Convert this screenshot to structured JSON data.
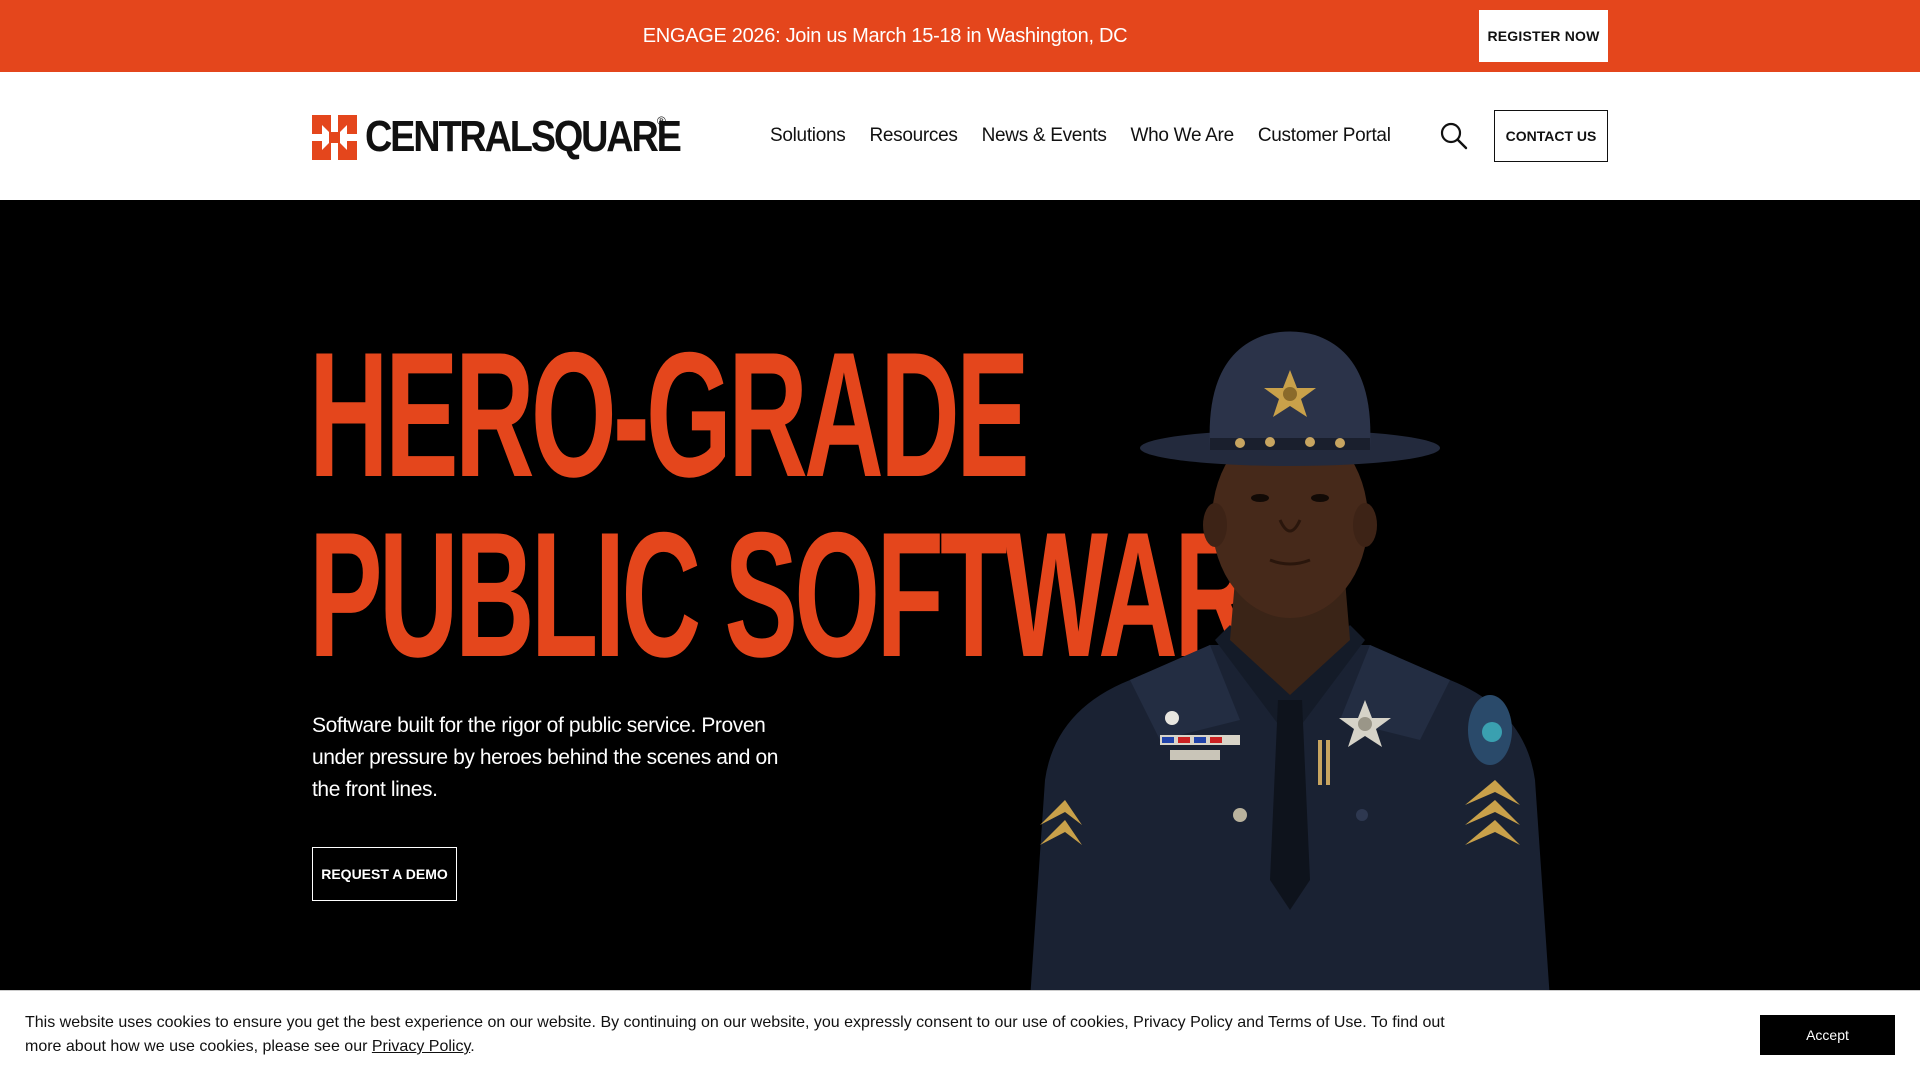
{
  "announcement": {
    "text": "ENGAGE 2026: Join us March 15-18 in Washington, DC",
    "register_label": "REGISTER NOW"
  },
  "header": {
    "logo_text": "CENTRALSQUARE",
    "logo_registered": "®",
    "nav": [
      "Solutions",
      "Resources",
      "News & Events",
      "Who We Are",
      "Customer Portal"
    ],
    "search_icon": "search-icon",
    "contact_label": "CONTACT US"
  },
  "hero": {
    "headline_line1": "HERO-GRADE",
    "headline_line2": "PUBLIC SOFTWARE",
    "subtext": "Software built for the rigor of public service. Proven under pressure by heroes behind the scenes and on the front lines.",
    "cta_label": "REQUEST A DEMO"
  },
  "cookie_banner": {
    "text": "This website uses cookies to ensure you get the best experience on our website. By continuing on our website, you expressly consent to our use of cookies, Privacy Policy and Terms of Use. To find out more about how we use cookies, please see our",
    "link_label": "Privacy Policy",
    "after_link": ".",
    "accept_label": "Accept"
  },
  "colors": {
    "brand_orange": "#e4461c",
    "hero_background": "#000000",
    "uniform_navy": "#1a2233"
  }
}
